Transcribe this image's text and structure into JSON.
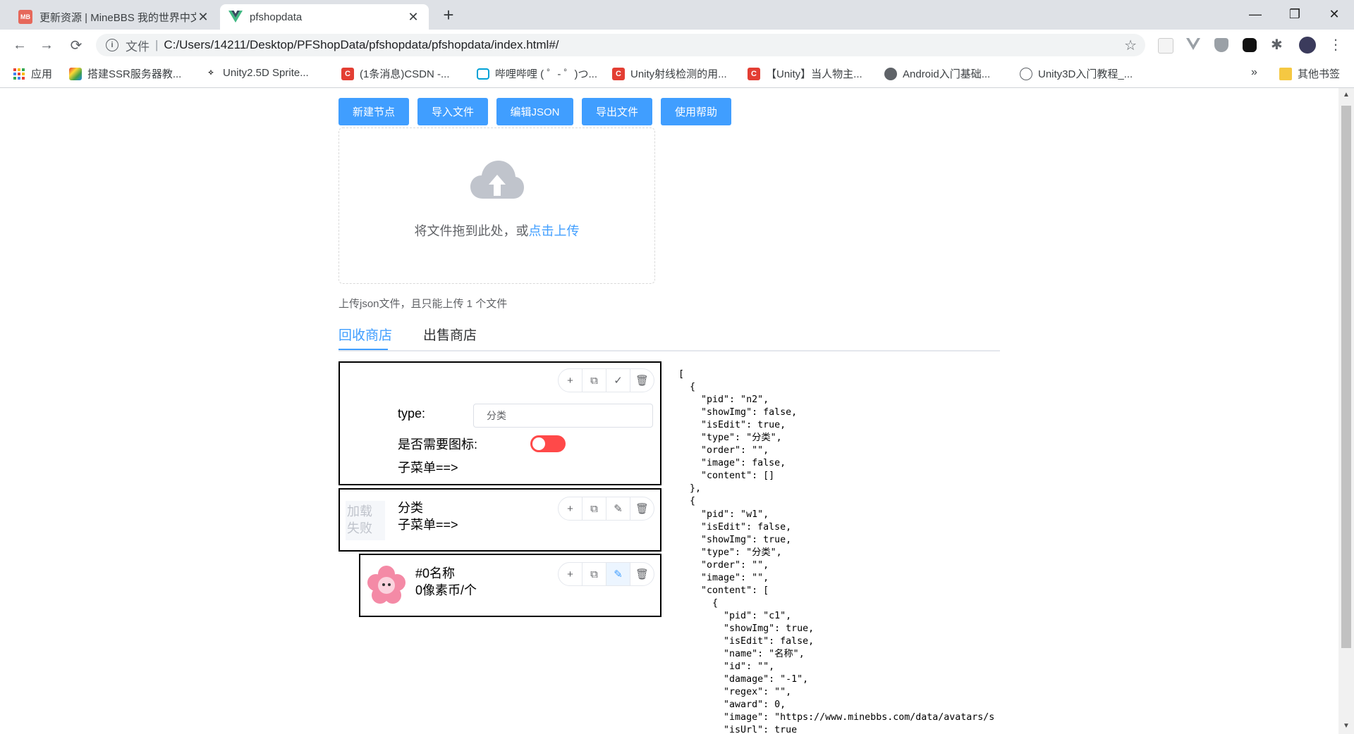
{
  "browser": {
    "tabs": [
      {
        "title": "更新资源 | MineBBS 我的世界中文论坛",
        "favicon": "MB",
        "active": false
      },
      {
        "title": "pfshopdata",
        "favicon": "vue-icon",
        "active": true
      }
    ],
    "address": {
      "scheme": "文件",
      "url": "C:/Users/14211/Desktop/PFShopData/pfshopdata/pfshopdata/index.html#/"
    },
    "bookmarks": [
      {
        "label": "应用",
        "icon": "apps-icon"
      },
      {
        "label": "搭建SSR服务器教...",
        "icon": "rainbow-icon"
      },
      {
        "label": "Unity2.5D Sprite...",
        "icon": "unity-icon"
      },
      {
        "label": "(1条消息)CSDN -...",
        "icon": "csdn-icon"
      },
      {
        "label": "哔哩哔哩 ( ゜- ゜)つ...",
        "icon": "bilibili-icon"
      },
      {
        "label": "Unity射线检测的用...",
        "icon": "csdn-icon"
      },
      {
        "label": "【Unity】当人物主...",
        "icon": "csdn-icon"
      },
      {
        "label": "Android入门基础...",
        "icon": "globe-icon"
      },
      {
        "label": "Unity3D入门教程_...",
        "icon": "globe-icon"
      }
    ],
    "bookmarks_overflow": "»",
    "other_bookmarks": "其他书签"
  },
  "toolbar": {
    "buttons": [
      "新建节点",
      "导入文件",
      "编辑JSON",
      "导出文件",
      "使用帮助"
    ]
  },
  "upload": {
    "text": "将文件拖到此处，或",
    "link": "点击上传",
    "tip": "上传json文件，且只能上传 1 个文件"
  },
  "tabs": [
    {
      "label": "回收商店",
      "active": true
    },
    {
      "label": "出售商店",
      "active": false
    }
  ],
  "cards": {
    "edit_card": {
      "type_label": "type:",
      "type_value": "分类",
      "need_icon_label": "是否需要图标:",
      "need_icon_on": false,
      "submenu_label": "子菜单==>"
    },
    "category_card": {
      "image_failed": "加载失败",
      "name": "分类",
      "submenu_label": "子菜单==>"
    },
    "item_card": {
      "name": "#0名称",
      "price": "0像素币/个"
    }
  },
  "json_preview": "[\n  {\n    \"pid\": \"n2\",\n    \"showImg\": false,\n    \"isEdit\": true,\n    \"type\": \"分类\",\n    \"order\": \"\",\n    \"image\": false,\n    \"content\": []\n  },\n  {\n    \"pid\": \"w1\",\n    \"isEdit\": false,\n    \"showImg\": true,\n    \"type\": \"分类\",\n    \"order\": \"\",\n    \"image\": \"\",\n    \"content\": [\n      {\n        \"pid\": \"c1\",\n        \"showImg\": true,\n        \"isEdit\": false,\n        \"name\": \"名称\",\n        \"id\": \"\",\n        \"damage\": \"-1\",\n        \"regex\": \"\",\n        \"award\": 0,\n        \"image\": \"https://www.minebbs.com/data/avatars/s\n        \"isUrl\": true",
  "colors": {
    "primary": "#409eff",
    "switch_off": "#ff4949",
    "tabbar": "#dee1e6"
  }
}
